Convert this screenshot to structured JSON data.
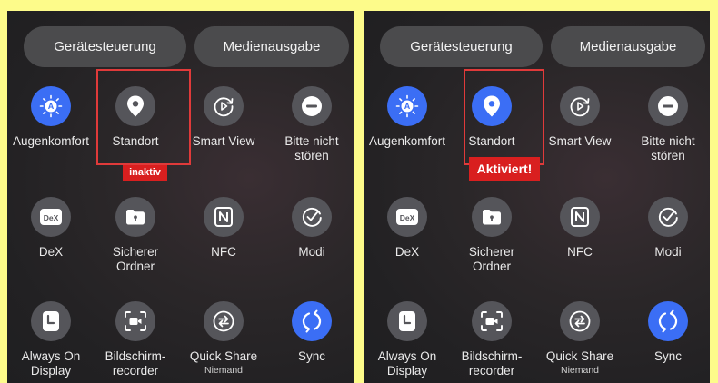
{
  "panels": [
    {
      "pills": [
        "Gerätesteuerung",
        "Medienausgabe"
      ],
      "tiles": [
        {
          "icon": "eye-comfort-icon",
          "label": "Augenkomfort",
          "active": true
        },
        {
          "icon": "location-pin-icon",
          "label": "Standort",
          "active": false
        },
        {
          "icon": "smart-view-icon",
          "label": "Smart View",
          "active": false
        },
        {
          "icon": "do-not-disturb-icon",
          "label": "Bitte nicht\nstören",
          "active": false
        },
        {
          "icon": "dex-icon",
          "label": "DeX",
          "active": false
        },
        {
          "icon": "secure-folder-icon",
          "label": "Sicherer\nOrdner",
          "active": false
        },
        {
          "icon": "nfc-icon",
          "label": "NFC",
          "active": false
        },
        {
          "icon": "modes-icon",
          "label": "Modi",
          "active": false
        },
        {
          "icon": "always-on-display-icon",
          "label": "Always On\nDisplay",
          "active": false
        },
        {
          "icon": "screen-recorder-icon",
          "label": "Bildschirm-\nrecorder",
          "active": false
        },
        {
          "icon": "quick-share-icon",
          "label": "Quick Share",
          "sub": "Niemand",
          "active": false
        },
        {
          "icon": "sync-icon",
          "label": "Sync",
          "active": true
        }
      ],
      "badge": "inaktiv"
    },
    {
      "pills": [
        "Gerätesteuerung",
        "Medienausgabe"
      ],
      "tiles": [
        {
          "icon": "eye-comfort-icon",
          "label": "Augenkomfort",
          "active": true
        },
        {
          "icon": "location-pin-icon",
          "label": "Standort",
          "active": true
        },
        {
          "icon": "smart-view-icon",
          "label": "Smart View",
          "active": false
        },
        {
          "icon": "do-not-disturb-icon",
          "label": "Bitte nicht\nstören",
          "active": false
        },
        {
          "icon": "dex-icon",
          "label": "DeX",
          "active": false
        },
        {
          "icon": "secure-folder-icon",
          "label": "Sicherer\nOrdner",
          "active": false
        },
        {
          "icon": "nfc-icon",
          "label": "NFC",
          "active": false
        },
        {
          "icon": "modes-icon",
          "label": "Modi",
          "active": false
        },
        {
          "icon": "always-on-display-icon",
          "label": "Always On\nDisplay",
          "active": false
        },
        {
          "icon": "screen-recorder-icon",
          "label": "Bildschirm-\nrecorder",
          "active": false
        },
        {
          "icon": "quick-share-icon",
          "label": "Quick Share",
          "sub": "Niemand",
          "active": false
        },
        {
          "icon": "sync-icon",
          "label": "Sync",
          "active": true
        }
      ],
      "badge": "Aktiviert!"
    }
  ],
  "colors": {
    "active": "#3b6ef5",
    "inactive": "#55555a",
    "highlight": "#e03a3a",
    "badge": "#d91f1f",
    "background": "#fdfb8a"
  }
}
